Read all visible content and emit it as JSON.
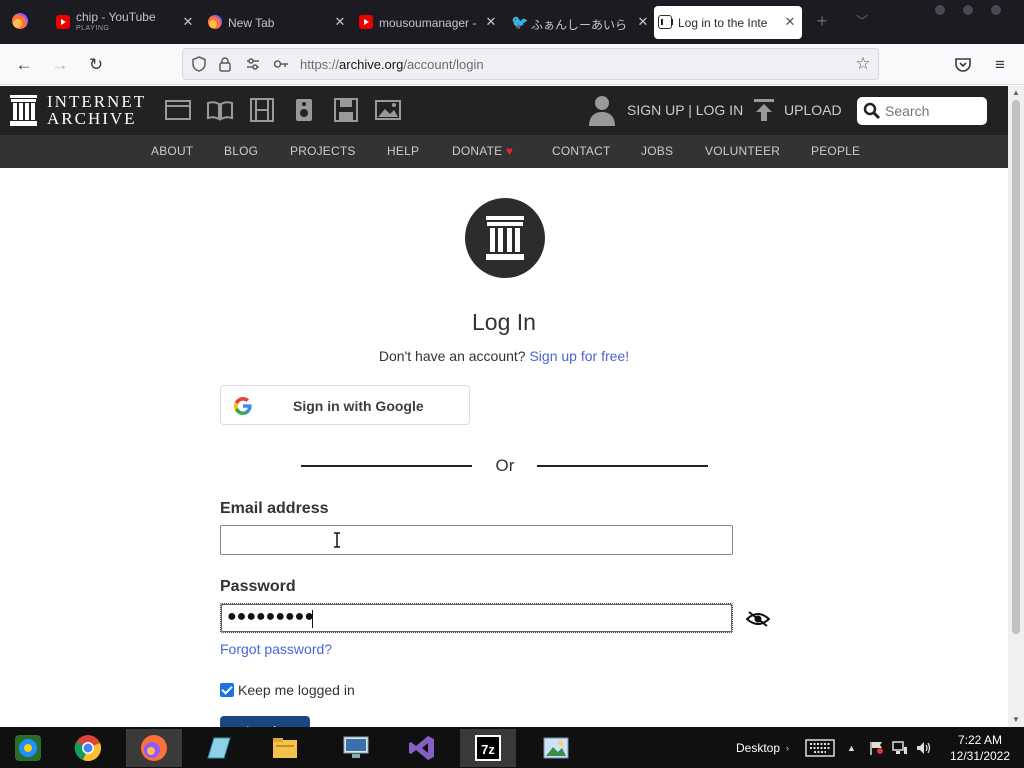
{
  "browser": {
    "tabs": [
      {
        "title": "chip - YouTube",
        "sub": "PLAYING",
        "icon": "youtube-icon"
      },
      {
        "title": "New Tab",
        "icon": "firefox-icon"
      },
      {
        "title": "mousoumanager - ",
        "icon": "youtube-icon"
      },
      {
        "title": "ふぁんしーあいら",
        "icon": "twitter-icon"
      },
      {
        "title": "Log in to the Inte",
        "icon": "internet-archive-icon"
      }
    ],
    "url_prefix": "https://",
    "url_domain": "archive.org",
    "url_path": "/account/login"
  },
  "ia_header": {
    "wordmark_line1": "INTERNET",
    "wordmark_line2": "ARCHIVE",
    "signup_login": "SIGN UP | LOG IN",
    "upload": "UPLOAD",
    "search_placeholder": "Search",
    "media_icons": [
      "web-icon",
      "texts-icon",
      "video-icon",
      "audio-icon",
      "software-icon",
      "images-icon"
    ],
    "subnav": [
      "ABOUT",
      "BLOG",
      "PROJECTS",
      "HELP",
      "DONATE",
      "CONTACT",
      "JOBS",
      "VOLUNTEER",
      "PEOPLE"
    ]
  },
  "login": {
    "title": "Log In",
    "no_account": "Don't have an account?",
    "signup_link": "Sign up for free!",
    "google_button": "Sign in with Google",
    "or": "Or",
    "email_label": "Email address",
    "email_value": "",
    "password_label": "Password",
    "password_masked": "●●●●●●●●●",
    "forgot": "Forgot password?",
    "keep_logged_in": "Keep me logged in",
    "keep_checked": true,
    "submit": "Log in"
  },
  "taskbar": {
    "apps": [
      "windows-start-icon",
      "chrome-icon",
      "firefox-icon",
      "notepad-icon",
      "file-explorer-icon",
      "remote-desktop-icon",
      "visual-studio-icon",
      "7zip-icon",
      "photos-icon"
    ],
    "desktop_label": "Desktop",
    "time": "7:22 AM",
    "date": "12/31/2022"
  },
  "colors": {
    "ia_header": "#222222",
    "ia_subnav": "#333333",
    "link_blue": "#4b64d6",
    "login_button": "#194880",
    "checkbox": "#1a73e8"
  }
}
